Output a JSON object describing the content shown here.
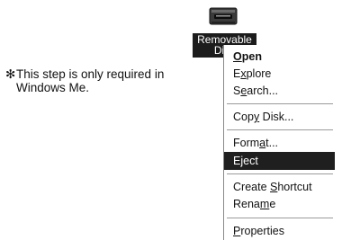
{
  "note": {
    "marker": "✻",
    "text": "This step is only required in Windows Me."
  },
  "desktop_icon": {
    "icon": "removable-disk-icon",
    "label_line1": "Removable",
    "label_line2": "Disk"
  },
  "context_menu": {
    "items": [
      {
        "label": "Open",
        "pre": "",
        "accel": "O",
        "post": "pen",
        "bold": true,
        "selected": false
      },
      {
        "label": "Explore",
        "pre": "E",
        "accel": "x",
        "post": "plore",
        "bold": false,
        "selected": false
      },
      {
        "label": "Search...",
        "pre": "S",
        "accel": "e",
        "post": "arch...",
        "bold": false,
        "selected": false
      },
      {
        "label": "Copy Disk...",
        "pre": "Cop",
        "accel": "y",
        "post": " Disk...",
        "bold": false,
        "selected": false
      },
      {
        "label": "Format...",
        "pre": "Form",
        "accel": "a",
        "post": "t...",
        "bold": false,
        "selected": false
      },
      {
        "label": "Eject",
        "pre": "E",
        "accel": "j",
        "post": "ect",
        "bold": false,
        "selected": true
      },
      {
        "label": "Create Shortcut",
        "pre": "Create ",
        "accel": "S",
        "post": "hortcut",
        "bold": false,
        "selected": false
      },
      {
        "label": "Rename",
        "pre": "Rena",
        "accel": "m",
        "post": "e",
        "bold": false,
        "selected": false
      },
      {
        "label": "Properties",
        "pre": "",
        "accel": "P",
        "post": "roperties",
        "bold": false,
        "selected": false
      }
    ]
  },
  "colors": {
    "selected_bg": "#1f1f1f",
    "label_bg": "#1c1c1c"
  }
}
